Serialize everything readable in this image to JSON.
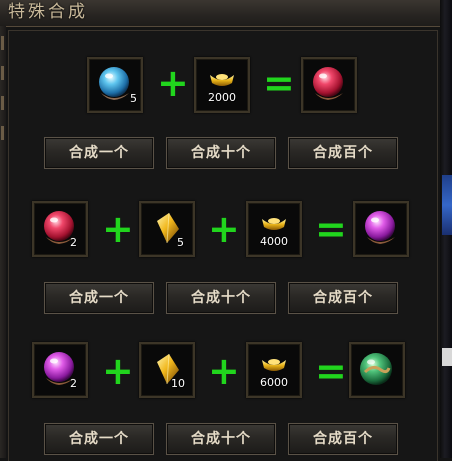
{
  "window": {
    "title": "特殊合成"
  },
  "colors": {
    "plus_equals": "#21d51d",
    "button_text": "#e6dcc8",
    "slot_border": "#3c3527"
  },
  "recipes": [
    {
      "ingredients": [
        {
          "icon": "blue-orb-icon",
          "count": "5"
        },
        {
          "icon": "gold-ingot-icon",
          "count": "2000"
        }
      ],
      "result": {
        "icon": "red-orb-icon"
      },
      "buttons": [
        "合成一个",
        "合成十个",
        "合成百个"
      ]
    },
    {
      "ingredients": [
        {
          "icon": "red-orb-icon",
          "count": "2"
        },
        {
          "icon": "gold-crystal-icon",
          "count": "5"
        },
        {
          "icon": "gold-ingot-icon",
          "count": "4000"
        }
      ],
      "result": {
        "icon": "purple-orb-icon"
      },
      "buttons": [
        "合成一个",
        "合成十个",
        "合成百个"
      ]
    },
    {
      "ingredients": [
        {
          "icon": "purple-orb-icon",
          "count": "2"
        },
        {
          "icon": "gold-crystal-icon",
          "count": "10"
        },
        {
          "icon": "gold-ingot-icon",
          "count": "6000"
        }
      ],
      "result": {
        "icon": "green-orb-icon"
      },
      "buttons": [
        "合成一个",
        "合成十个",
        "合成百个"
      ]
    }
  ],
  "operators": {
    "plus": "+",
    "equals": "="
  }
}
